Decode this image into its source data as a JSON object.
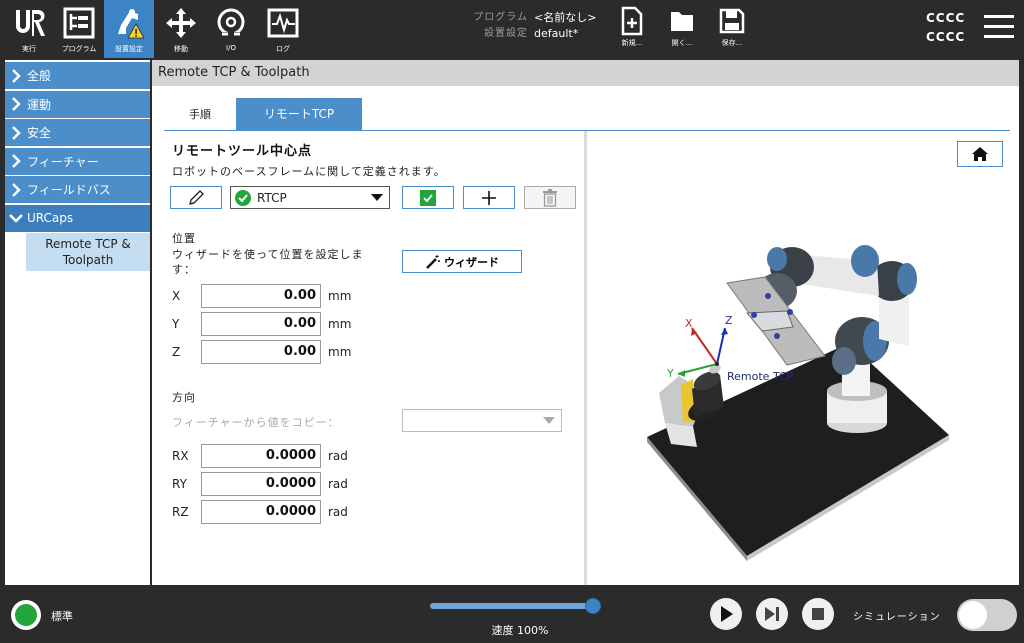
{
  "topbar": {
    "nav": [
      {
        "label": "実行",
        "icon": "ur-logo-icon"
      },
      {
        "label": "プログラム",
        "icon": "program-tree-icon"
      },
      {
        "label": "設置設定",
        "icon": "installation-warning-icon"
      },
      {
        "label": "移動",
        "icon": "move-arrows-icon"
      },
      {
        "label": "I/O",
        "icon": "io-icon"
      },
      {
        "label": "ログ",
        "icon": "log-chart-icon"
      }
    ],
    "program_key": "プログラム",
    "program_value": "<名前なし>",
    "installation_key": "設置設定",
    "installation_value": "default*",
    "file": [
      {
        "label": "新規...",
        "icon": "new-file-icon"
      },
      {
        "label": "開く...",
        "icon": "open-folder-icon"
      },
      {
        "label": "保存...",
        "icon": "save-icon"
      }
    ],
    "user_line1": "CCCC",
    "user_line2": "CCCC"
  },
  "sidebar": {
    "items": [
      {
        "label": "全般"
      },
      {
        "label": "運動"
      },
      {
        "label": "安全"
      },
      {
        "label": "フィーチャー"
      },
      {
        "label": "フィールドバス"
      },
      {
        "label": "URCaps"
      }
    ],
    "sub_item": "Remote TCP & Toolpath"
  },
  "main": {
    "title": "Remote TCP & Toolpath",
    "tabs": [
      {
        "label": "手順"
      },
      {
        "label": "リモートTCP"
      }
    ],
    "heading": "リモートツール中心点",
    "description": "ロボットのベースフレームに関して定義されます。",
    "tcp_select": "RTCP",
    "position_label": "位置",
    "wizard_text": "ウィザードを使って位置を設定します：",
    "wizard_button": "ウィザード",
    "position": [
      {
        "axis": "X",
        "value": "0.00",
        "unit": "mm"
      },
      {
        "axis": "Y",
        "value": "0.00",
        "unit": "mm"
      },
      {
        "axis": "Z",
        "value": "0.00",
        "unit": "mm"
      }
    ],
    "orientation_label": "方向",
    "copy_from_feature": "フィーチャーから値をコピー：",
    "orientation": [
      {
        "axis": "RX",
        "value": "0.0000",
        "unit": "rad"
      },
      {
        "axis": "RY",
        "value": "0.0000",
        "unit": "rad"
      },
      {
        "axis": "RZ",
        "value": "0.0000",
        "unit": "rad"
      }
    ],
    "scene_axis_x": "X",
    "scene_axis_y": "Y",
    "scene_axis_z": "Z",
    "scene_label": "Remote TCP"
  },
  "bottombar": {
    "mode": "標準",
    "speed": "速度 100%",
    "speed_fraction": 1.0,
    "simulation": "シミュレーション",
    "colors": {
      "accent": "#3d84c6",
      "ok": "#22a63a"
    }
  }
}
